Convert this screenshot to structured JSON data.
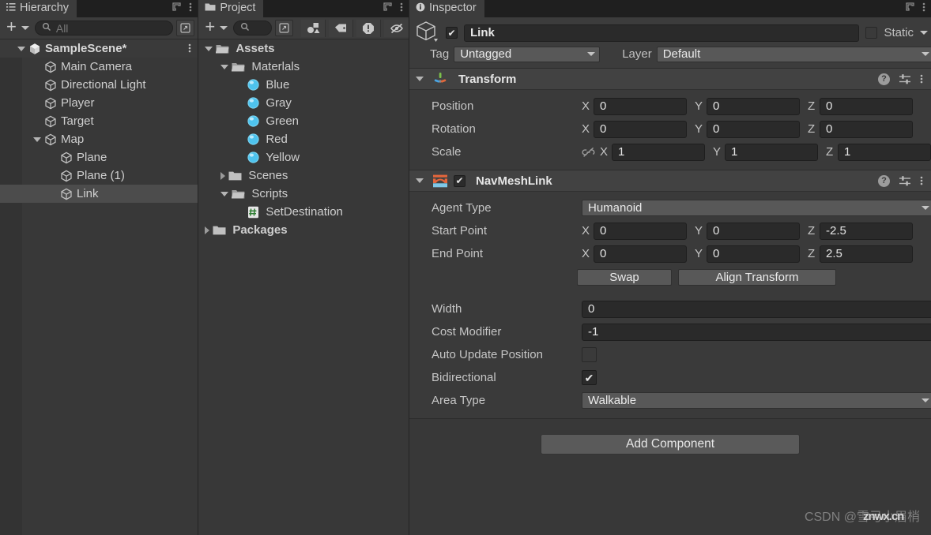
{
  "hierarchy": {
    "tab_label": "Hierarchy",
    "toolbar": {
      "add_label": "+",
      "search_placeholder": "All"
    },
    "items": [
      {
        "label": "SampleScene*",
        "icon": "unity-scene-icon",
        "indent": 0,
        "foldout": "open",
        "type": "scene",
        "selected": false
      },
      {
        "label": "Main Camera",
        "icon": "gameobject-cube-icon",
        "indent": 1,
        "foldout": "none",
        "type": "object",
        "selected": false
      },
      {
        "label": "Directional Light",
        "icon": "gameobject-cube-icon",
        "indent": 1,
        "foldout": "none",
        "type": "object",
        "selected": false
      },
      {
        "label": "Player",
        "icon": "gameobject-cube-icon",
        "indent": 1,
        "foldout": "none",
        "type": "object",
        "selected": false
      },
      {
        "label": "Target",
        "icon": "gameobject-cube-icon",
        "indent": 1,
        "foldout": "none",
        "type": "object",
        "selected": false
      },
      {
        "label": "Map",
        "icon": "gameobject-cube-icon",
        "indent": 1,
        "foldout": "open",
        "type": "object",
        "selected": false
      },
      {
        "label": "Plane",
        "icon": "gameobject-cube-icon",
        "indent": 2,
        "foldout": "none",
        "type": "object",
        "selected": false
      },
      {
        "label": "Plane (1)",
        "icon": "gameobject-cube-icon",
        "indent": 2,
        "foldout": "none",
        "type": "object",
        "selected": false
      },
      {
        "label": "Link",
        "icon": "gameobject-cube-icon",
        "indent": 2,
        "foldout": "none",
        "type": "object",
        "selected": true
      }
    ]
  },
  "project": {
    "tab_label": "Project",
    "toolbar": {
      "add_label": "+",
      "search_placeholder": ""
    },
    "filters": [
      "type-filter-icon",
      "label-filter-icon",
      "warning-filter-icon",
      "hidden-filter-icon"
    ],
    "items": [
      {
        "label": "Assets",
        "icon": "folder-open-icon",
        "indent": 0,
        "foldout": "open",
        "bold": true
      },
      {
        "label": "Materlals",
        "icon": "folder-open-icon",
        "indent": 1,
        "foldout": "open",
        "bold": false
      },
      {
        "label": "Blue",
        "icon": "material-sphere-icon",
        "indent": 2,
        "foldout": "none",
        "bold": false
      },
      {
        "label": "Gray",
        "icon": "material-sphere-icon",
        "indent": 2,
        "foldout": "none",
        "bold": false
      },
      {
        "label": "Green",
        "icon": "material-sphere-icon",
        "indent": 2,
        "foldout": "none",
        "bold": false
      },
      {
        "label": "Red",
        "icon": "material-sphere-icon",
        "indent": 2,
        "foldout": "none",
        "bold": false
      },
      {
        "label": "Yellow",
        "icon": "material-sphere-icon",
        "indent": 2,
        "foldout": "none",
        "bold": false
      },
      {
        "label": "Scenes",
        "icon": "folder-closed-icon",
        "indent": 1,
        "foldout": "closed",
        "bold": false
      },
      {
        "label": "Scripts",
        "icon": "folder-open-icon",
        "indent": 1,
        "foldout": "open",
        "bold": false
      },
      {
        "label": "SetDestination",
        "icon": "csharp-script-icon",
        "indent": 2,
        "foldout": "none",
        "bold": false
      },
      {
        "label": "Packages",
        "icon": "folder-closed-icon",
        "indent": 0,
        "foldout": "closed",
        "bold": true
      }
    ]
  },
  "inspector": {
    "tab_label": "Inspector",
    "object": {
      "icon": "gameobject-cube-icon",
      "enabled": true,
      "name": "Link",
      "static_label": "Static",
      "static_checked": false,
      "tag_label": "Tag",
      "tag_value": "Untagged",
      "layer_label": "Layer",
      "layer_value": "Default"
    },
    "components": [
      {
        "title": "Transform",
        "icon": "transform-gizmo-icon",
        "expanded": true,
        "has_checkbox": false,
        "rows": [
          {
            "kind": "vector3",
            "label": "Position",
            "x": "0",
            "y": "0",
            "z": "0",
            "link_icon": false
          },
          {
            "kind": "vector3",
            "label": "Rotation",
            "x": "0",
            "y": "0",
            "z": "0",
            "link_icon": false
          },
          {
            "kind": "vector3",
            "label": "Scale",
            "x": "1",
            "y": "1",
            "z": "1",
            "link_icon": true
          }
        ]
      },
      {
        "title": "NavMeshLink",
        "icon": "navmeshlink-bridge-icon",
        "expanded": true,
        "has_checkbox": true,
        "checked": true,
        "rows": [
          {
            "kind": "dropdown",
            "label": "Agent Type",
            "value": "Humanoid"
          },
          {
            "kind": "vector3",
            "label": "Start Point",
            "x": "0",
            "y": "0",
            "z": "-2.5",
            "link_icon": false
          },
          {
            "kind": "vector3",
            "label": "End Point",
            "x": "0",
            "y": "0",
            "z": "2.5",
            "link_icon": false
          },
          {
            "kind": "buttons",
            "buttons": [
              "Swap",
              "Align Transform"
            ]
          },
          {
            "kind": "spacer"
          },
          {
            "kind": "text",
            "label": "Width",
            "value": "0"
          },
          {
            "kind": "text",
            "label": "Cost Modifier",
            "value": "-1"
          },
          {
            "kind": "checkbox",
            "label": "Auto Update Position",
            "checked": false
          },
          {
            "kind": "checkbox",
            "label": "Bidirectional",
            "checked": true
          },
          {
            "kind": "dropdown",
            "label": "Area Type",
            "value": "Walkable"
          }
        ]
      }
    ],
    "add_component_label": "Add Component"
  },
  "watermark": {
    "prefix": "CSDN @",
    "name": "雪弓小眉梢",
    "overlay": "znwx.cn"
  },
  "colors": {
    "panel_bg": "#383838",
    "tabbar_bg": "#1f1f1f",
    "tab_active": "#3c3c3c",
    "selection": "#4c4c4c",
    "field_bg": "#2a2a2a",
    "dropdown_bg": "#585858",
    "text": "#c4c4c4",
    "navmesh_accent": "#e4663c"
  }
}
